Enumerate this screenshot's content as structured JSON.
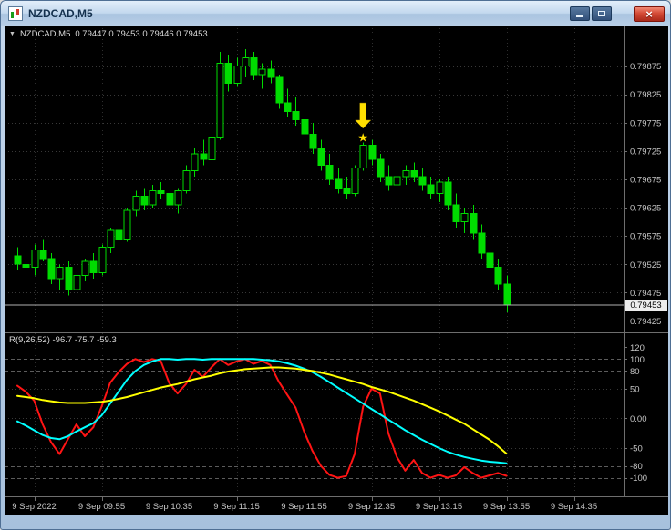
{
  "window": {
    "title": "NZDCAD,M5"
  },
  "icons": {
    "app": "chart-icon",
    "minimize": "minimize-icon",
    "restore": "restore-icon",
    "close": "close-icon",
    "close_glyph": "×",
    "dropdown_glyph": "▼",
    "star_glyph": "★"
  },
  "chart_header": {
    "symbol": "NZDCAD,M5",
    "ohlc": "0.79447 0.79453 0.79446 0.79453"
  },
  "price_axis": {
    "labels": [
      "0.79875",
      "0.79825",
      "0.79775",
      "0.79725",
      "0.79675",
      "0.79625",
      "0.79575",
      "0.79525",
      "0.79475",
      "0.79425"
    ],
    "bid": "0.79453",
    "bid_value": 0.79453
  },
  "time_axis": {
    "labels": [
      {
        "text": "9 Sep 2022",
        "candle_index": 2
      },
      {
        "text": "9 Sep 09:55",
        "candle_index": 10
      },
      {
        "text": "9 Sep 10:35",
        "candle_index": 18
      },
      {
        "text": "9 Sep 11:15",
        "candle_index": 26
      },
      {
        "text": "9 Sep 11:55",
        "candle_index": 34
      },
      {
        "text": "9 Sep 12:35",
        "candle_index": 42
      },
      {
        "text": "9 Sep 13:15",
        "candle_index": 50
      },
      {
        "text": "9 Sep 13:55",
        "candle_index": 58
      },
      {
        "text": "9 Sep 14:35",
        "candle_index": 66
      }
    ]
  },
  "indicator": {
    "label": "R(9,26,52) -96.7 -75.7 -59.3",
    "scale": [
      {
        "text": "120",
        "value": 120
      },
      {
        "text": "100",
        "value": 100
      },
      {
        "text": "80",
        "value": 80
      },
      {
        "text": "50",
        "value": 50
      },
      {
        "text": "0.00",
        "value": 0
      },
      {
        "text": "-50",
        "value": -50
      },
      {
        "text": "-80",
        "value": -80
      },
      {
        "text": "-100",
        "value": -100
      }
    ],
    "dashed_levels": [
      100,
      80,
      -80,
      -100
    ],
    "dotted_levels": [
      50,
      0,
      -50
    ],
    "range": {
      "max": 143.5,
      "min": -131.3
    }
  },
  "chart_data": {
    "type": "candlestick",
    "symbol": "NZDCAD",
    "timeframe": "M5",
    "price_range": {
      "max": 0.79942,
      "min": 0.79408
    },
    "grid_step": 0.0005,
    "candles": [
      [
        0.7954,
        0.79555,
        0.79515,
        0.79525
      ],
      [
        0.79525,
        0.79545,
        0.795,
        0.7952
      ],
      [
        0.7952,
        0.7956,
        0.79505,
        0.7955
      ],
      [
        0.7955,
        0.7957,
        0.7953,
        0.79535
      ],
      [
        0.79535,
        0.79545,
        0.7949,
        0.795
      ],
      [
        0.795,
        0.79525,
        0.7948,
        0.7952
      ],
      [
        0.7952,
        0.7953,
        0.7947,
        0.7948
      ],
      [
        0.7948,
        0.7951,
        0.79465,
        0.79505
      ],
      [
        0.79505,
        0.79535,
        0.79495,
        0.7953
      ],
      [
        0.7953,
        0.79545,
        0.795,
        0.7951
      ],
      [
        0.7951,
        0.7956,
        0.79505,
        0.79555
      ],
      [
        0.79555,
        0.7959,
        0.79545,
        0.79585
      ],
      [
        0.79585,
        0.796,
        0.7956,
        0.7957
      ],
      [
        0.7957,
        0.79625,
        0.79565,
        0.7962
      ],
      [
        0.7962,
        0.79655,
        0.7961,
        0.79645
      ],
      [
        0.79645,
        0.7966,
        0.7962,
        0.7963
      ],
      [
        0.7963,
        0.79665,
        0.79625,
        0.79655
      ],
      [
        0.79655,
        0.7967,
        0.7964,
        0.7965
      ],
      [
        0.7965,
        0.79665,
        0.7962,
        0.7963
      ],
      [
        0.7963,
        0.7966,
        0.79615,
        0.79655
      ],
      [
        0.79655,
        0.797,
        0.7965,
        0.7969
      ],
      [
        0.7969,
        0.7973,
        0.7968,
        0.7972
      ],
      [
        0.7972,
        0.79745,
        0.797,
        0.7971
      ],
      [
        0.7971,
        0.79755,
        0.79705,
        0.7975
      ],
      [
        0.7975,
        0.799,
        0.79745,
        0.7988
      ],
      [
        0.7988,
        0.79895,
        0.7983,
        0.79845
      ],
      [
        0.79845,
        0.7989,
        0.7984,
        0.79875
      ],
      [
        0.79875,
        0.79905,
        0.79855,
        0.7989
      ],
      [
        0.7989,
        0.799,
        0.7985,
        0.7986
      ],
      [
        0.7986,
        0.7988,
        0.79835,
        0.7987
      ],
      [
        0.7987,
        0.79885,
        0.79845,
        0.79855
      ],
      [
        0.79855,
        0.7986,
        0.798,
        0.7981
      ],
      [
        0.7981,
        0.79835,
        0.79785,
        0.79795
      ],
      [
        0.79795,
        0.7982,
        0.7977,
        0.7978
      ],
      [
        0.7978,
        0.798,
        0.79745,
        0.79755
      ],
      [
        0.79755,
        0.79775,
        0.7972,
        0.7973
      ],
      [
        0.7973,
        0.79745,
        0.7969,
        0.797
      ],
      [
        0.797,
        0.7972,
        0.79665,
        0.79675
      ],
      [
        0.79675,
        0.79695,
        0.7965,
        0.7966
      ],
      [
        0.7966,
        0.7968,
        0.7964,
        0.7965
      ],
      [
        0.7965,
        0.797,
        0.79645,
        0.79695
      ],
      [
        0.79695,
        0.7974,
        0.7969,
        0.79735
      ],
      [
        0.79735,
        0.79745,
        0.797,
        0.7971
      ],
      [
        0.7971,
        0.7972,
        0.7967,
        0.7968
      ],
      [
        0.7968,
        0.797,
        0.79655,
        0.79665
      ],
      [
        0.79665,
        0.7969,
        0.7965,
        0.7968
      ],
      [
        0.7968,
        0.797,
        0.79665,
        0.7969
      ],
      [
        0.7969,
        0.79705,
        0.7967,
        0.7968
      ],
      [
        0.7968,
        0.79695,
        0.79655,
        0.79665
      ],
      [
        0.79665,
        0.7968,
        0.7964,
        0.7965
      ],
      [
        0.7965,
        0.79675,
        0.79635,
        0.7967
      ],
      [
        0.7967,
        0.7968,
        0.7962,
        0.7963
      ],
      [
        0.7963,
        0.7965,
        0.7959,
        0.796
      ],
      [
        0.796,
        0.79625,
        0.7958,
        0.79615
      ],
      [
        0.79615,
        0.7963,
        0.7957,
        0.7958
      ],
      [
        0.7958,
        0.79595,
        0.79535,
        0.79545
      ],
      [
        0.79545,
        0.7956,
        0.7951,
        0.7952
      ],
      [
        0.7952,
        0.79535,
        0.7948,
        0.7949
      ],
      [
        0.7949,
        0.79505,
        0.7944,
        0.79453
      ]
    ],
    "series": [
      {
        "name": "r-fast",
        "color": "#ff1414",
        "values": [
          55,
          45,
          30,
          -10,
          -40,
          -60,
          -35,
          -10,
          -30,
          -15,
          20,
          60,
          78,
          92,
          100,
          95,
          100,
          97,
          60,
          42,
          58,
          82,
          70,
          86,
          100,
          90,
          96,
          100,
          92,
          97,
          90,
          62,
          40,
          18,
          -22,
          -55,
          -80,
          -95,
          -100,
          -97,
          -60,
          20,
          50,
          42,
          -25,
          -65,
          -88,
          -70,
          -92,
          -100,
          -95,
          -100,
          -96,
          -82,
          -92,
          -100,
          -96,
          -92,
          -96.7
        ]
      },
      {
        "name": "r-medium",
        "color": "#00ffff",
        "values": [
          -5,
          -12,
          -20,
          -28,
          -33,
          -35,
          -30,
          -22,
          -15,
          -8,
          5,
          25,
          45,
          65,
          80,
          90,
          96,
          100,
          100,
          99,
          100,
          100,
          99,
          100,
          100,
          100,
          100,
          100,
          100,
          99,
          98,
          96,
          93,
          89,
          84,
          78,
          70,
          61,
          52,
          43,
          34,
          25,
          16,
          7,
          -2,
          -11,
          -20,
          -28,
          -36,
          -43,
          -50,
          -56,
          -61,
          -65,
          -68,
          -71,
          -73,
          -74,
          -75.7
        ]
      },
      {
        "name": "r-slow",
        "color": "#ffff00",
        "values": [
          38,
          36,
          34,
          31,
          29,
          27,
          26,
          26,
          26,
          27,
          28,
          30,
          33,
          36,
          40,
          44,
          48,
          52,
          55,
          58,
          62,
          66,
          69,
          72,
          76,
          79,
          81,
          83,
          84,
          85,
          86,
          86,
          85,
          84,
          82,
          80,
          77,
          74,
          70,
          66,
          62,
          58,
          53,
          49,
          45,
          40,
          35,
          30,
          24,
          18,
          12,
          5,
          -2,
          -9,
          -18,
          -27,
          -36,
          -47,
          -59.3
        ]
      }
    ],
    "marker": {
      "type": "sell-signal",
      "candle_index": 41,
      "arrow_top_price": 0.7981,
      "arrow_tip_price": 0.79765,
      "star_price": 0.79748,
      "color": "#ffdf00"
    }
  },
  "colors": {
    "chart_background": "#000000",
    "bull_fill": "#000000",
    "candle_outline": "#00dc00",
    "bear_fill": "#00dc00",
    "grid": "#383838",
    "vgrid": "#2e2e2e",
    "axis_line": "#6e6e6e",
    "axis_text": "#c6c6c6",
    "bid_line": "#b0b0b0",
    "level_dashed": "#5c5c5c",
    "level_dotted": "#383838"
  }
}
